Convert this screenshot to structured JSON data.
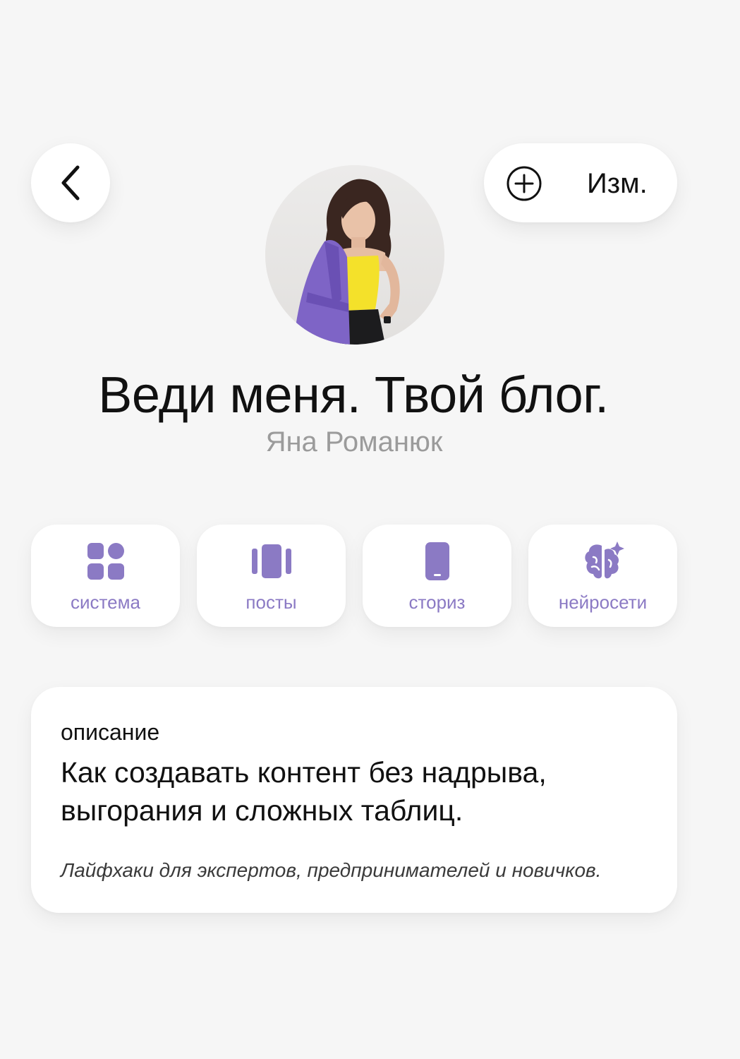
{
  "header": {
    "back_icon": "chevron-left-icon",
    "edit_icon": "plus-circle-icon",
    "edit_label": "Изм."
  },
  "profile": {
    "avatar": "avatar-photo",
    "title": "Веди меня. Твой блог.",
    "author": "Яна Романюк"
  },
  "categories": [
    {
      "label": "система",
      "icon": "grid-icon"
    },
    {
      "label": "посты",
      "icon": "carousel-icon"
    },
    {
      "label": "сториз",
      "icon": "phone-icon"
    },
    {
      "label": "нейросети",
      "icon": "brain-sparkle-icon"
    }
  ],
  "description": {
    "heading": "описание",
    "main": "Как создавать контент без надрыва,\nвыгорания и сложных таблиц.",
    "note": "Лайфхаки для экспертов, предпринимателей и новичков."
  },
  "colors": {
    "background": "#f6f6f6",
    "accent": "#8b7ac4",
    "subtitle": "#9b9b9b"
  }
}
